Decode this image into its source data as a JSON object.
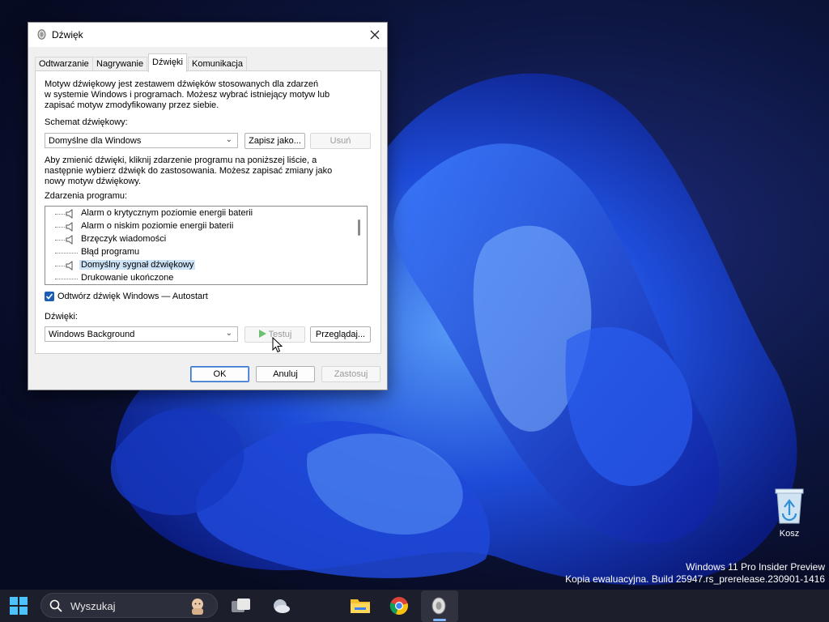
{
  "dialog": {
    "title": "Dźwięk",
    "close_icon": "close-icon",
    "tabs": [
      {
        "label": "Odtwarzanie",
        "active": false
      },
      {
        "label": "Nagrywanie",
        "active": false
      },
      {
        "label": "Dźwięki",
        "active": true
      },
      {
        "label": "Komunikacja",
        "active": false
      }
    ],
    "intro_lines": [
      "Motyw dźwiękowy jest zestawem dźwięków stosowanych dla zdarzeń",
      "w systemie Windows i programach. Możesz wybrać istniejący motyw lub",
      "zapisać motyw zmodyfikowany przez siebie."
    ],
    "scheme_label": "Schemat dźwiękowy:",
    "scheme_value": "Domyślne dla Windows",
    "save_as_label": "Zapisz jako...",
    "delete_label": "Usuń",
    "instructions_lines": [
      "Aby zmienić dźwięki, kliknij zdarzenie programu na poniższej liście, a",
      "następnie wybierz dźwięk do zastosowania. Możesz zapisać zmiany jako",
      "nowy motyw dźwiękowy."
    ],
    "events_label": "Zdarzenia programu:",
    "events": [
      {
        "label": "Alarm o krytycznym poziomie energii baterii",
        "has_sound": true,
        "selected": false
      },
      {
        "label": "Alarm o niskim poziomie energii baterii",
        "has_sound": true,
        "selected": false
      },
      {
        "label": "Brzęczyk wiadomości",
        "has_sound": true,
        "selected": false
      },
      {
        "label": "Błąd programu",
        "has_sound": false,
        "selected": false
      },
      {
        "label": "Domyślny sygnał dźwiękowy",
        "has_sound": true,
        "selected": true
      },
      {
        "label": "Drukowanie ukończone",
        "has_sound": false,
        "selected": false
      }
    ],
    "startup_checkbox_label": "Odtwórz dźwięk Windows — Autostart",
    "startup_checked": true,
    "sounds_label": "Dźwięki:",
    "sound_value": "Windows Background",
    "test_label": "Testuj",
    "browse_label": "Przeglądaj...",
    "ok_label": "OK",
    "cancel_label": "Anuluj",
    "apply_label": "Zastosuj"
  },
  "desktop": {
    "recycle_bin_label": "Kosz",
    "watermark_line1": "Windows 11 Pro Insider Preview",
    "watermark_line2": "Kopia ewaluacyjna. Build 25947.rs_prerelease.230901-1416"
  },
  "taskbar": {
    "search_placeholder": "Wyszukaj",
    "icons": [
      "start-icon",
      "search-icon",
      "task-view-icon",
      "weather-icon",
      "file-explorer-icon",
      "chrome-icon",
      "sound-app-icon"
    ]
  },
  "colors": {
    "accent": "#1a5fb4",
    "selection": "#cde3f7",
    "taskbar": "#1c1f2b"
  }
}
